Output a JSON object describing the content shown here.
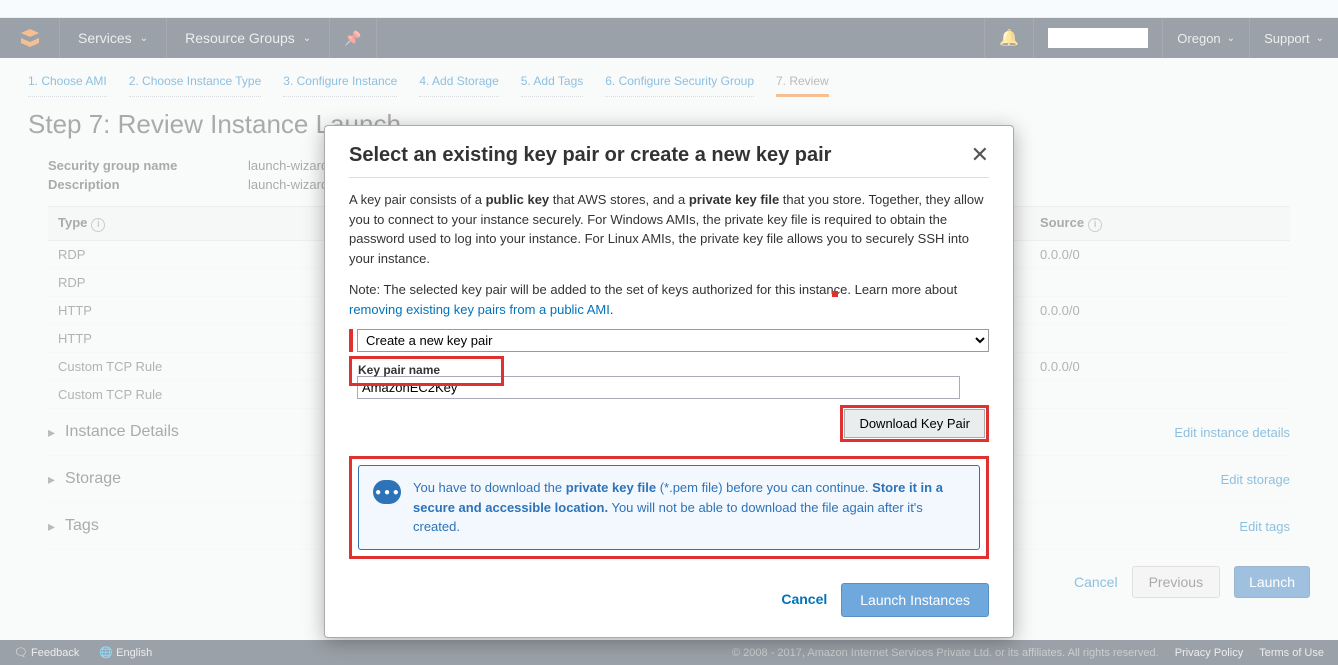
{
  "nav": {
    "services": "Services",
    "resource_groups": "Resource Groups",
    "region": "Oregon",
    "support": "Support"
  },
  "wizard": {
    "steps": [
      "1. Choose AMI",
      "2. Choose Instance Type",
      "3. Configure Instance",
      "4. Add Storage",
      "5. Add Tags",
      "6. Configure Security Group",
      "7. Review"
    ],
    "active": 6
  },
  "page_title": "Step 7: Review Instance Launch",
  "sg": {
    "name_label": "Security group name",
    "desc_label": "Description",
    "name_value": "launch-wizard",
    "desc_value": "launch-wizard"
  },
  "table": {
    "th_type": "Type",
    "th_source": "Source",
    "rows": [
      {
        "type": "RDP",
        "source": "0.0.0/0"
      },
      {
        "type": "RDP",
        "source": ""
      },
      {
        "type": "HTTP",
        "source": "0.0.0/0"
      },
      {
        "type": "HTTP",
        "source": ""
      },
      {
        "type": "Custom TCP Rule",
        "source": "0.0.0/0"
      },
      {
        "type": "Custom TCP Rule",
        "source": ""
      }
    ]
  },
  "toggles": {
    "instance": "Instance Details",
    "storage": "Storage",
    "tags": "Tags",
    "edit_instance": "Edit instance details",
    "edit_storage": "Edit storage",
    "edit_tags": "Edit tags"
  },
  "actions": {
    "cancel": "Cancel",
    "previous": "Previous",
    "launch": "Launch"
  },
  "footer": {
    "feedback": "Feedback",
    "language": "English",
    "copyright": "© 2008 - 2017, Amazon Internet Services Private Ltd. or its affiliates. All rights reserved.",
    "privacy": "Privacy Policy",
    "terms": "Terms of Use"
  },
  "modal": {
    "title": "Select an existing key pair or create a new key pair",
    "para1_a": "A key pair consists of a ",
    "para1_b": "public key",
    "para1_c": " that AWS stores, and a ",
    "para1_d": "private key file",
    "para1_e": " that you store. Together, they allow you to connect to your instance securely. For Windows AMIs, the private key file is required to obtain the password used to log into your instance. For Linux AMIs, the private key file allows you to securely SSH into your instance.",
    "para2_a": "Note: The selected key pair will be added to the set of keys authorized for this instance. Learn more about ",
    "para2_link": "removing existing key pairs from a public AMI",
    "para2_b": ".",
    "select_value": "Create a new key pair",
    "kp_label": "Key pair name",
    "kp_value": "AmazonEC2Key",
    "download": "Download Key Pair",
    "notice_a": "You have to download the ",
    "notice_b": "private key file",
    "notice_c": " (*.pem file) before you can continue. ",
    "notice_d": "Store it in a secure and accessible location.",
    "notice_e": " You will not be able to download the file again after it's created.",
    "cancel": "Cancel",
    "launch": "Launch Instances"
  }
}
